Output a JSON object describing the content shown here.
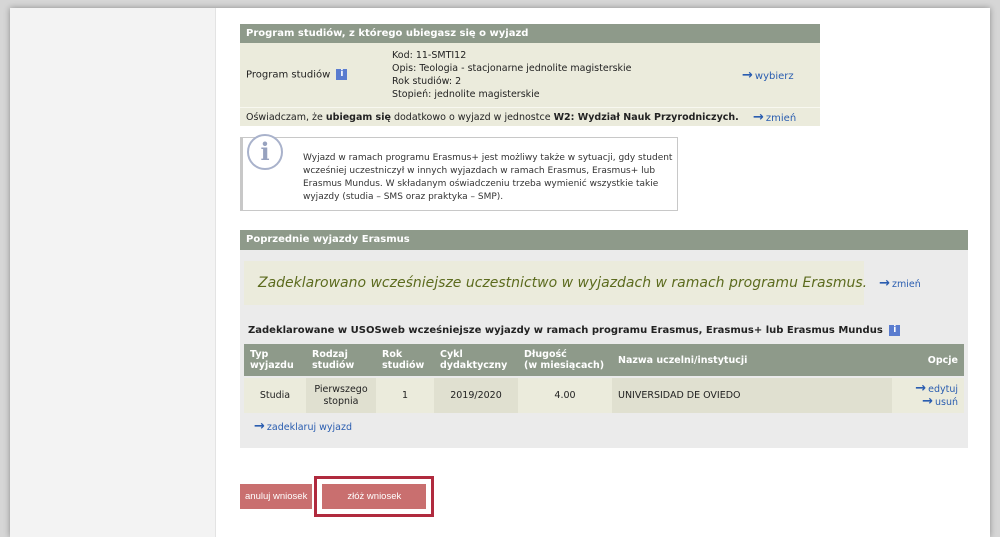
{
  "program": {
    "header": "Program studiów, z którego ubiegasz się o wyjazd",
    "label": "Program studiów",
    "details": [
      "Kod: 11-SMTI12",
      "Opis: Teologia - stacjonarne jednolite magisterskie",
      "Rok studiów: 2",
      "Stopień: jednolite magisterskie"
    ],
    "choose_link": "wybierz",
    "decl_prefix": "Oświadczam, że ",
    "decl_bold1": "ubiegam się",
    "decl_middle": " dodatkowo o wyjazd w jednostce ",
    "decl_bold2": "W2: Wydział Nauk Przyrodniczych.",
    "change_link": "zmień"
  },
  "notice": {
    "icon": "i",
    "text": "Wyjazd w ramach programu Erasmus+ jest możliwy także w sytuacji, gdy student wcześniej uczestniczył w innych wyjazdach w ramach Erasmus, Erasmus+ lub Erasmus Mundus. W składanym oświadczeniu trzeba wymienić wszystkie takie wyjazdy (studia – SMS oraz praktyka – SMP)."
  },
  "previous": {
    "header": "Poprzednie wyjazdy Erasmus",
    "declared_message": "Zadeklarowano wcześniejsze uczestnictwo w wyjazdach w ramach programu Erasmus.",
    "change_link": "zmień",
    "table_title": "Zadeklarowane w USOSweb wcześniejsze wyjazdy w ramach programu Erasmus, Erasmus+ lub Erasmus Mundus",
    "columns": {
      "c1a": "Typ",
      "c1b": "wyjazdu",
      "c2a": "Rodzaj",
      "c2b": "studiów",
      "c3a": "Rok",
      "c3b": "studiów",
      "c4a": "Cykl",
      "c4b": "dydaktyczny",
      "c5a": "Długość",
      "c5b": "(w miesiącach)",
      "c6": "Nazwa uczelni/instytucji",
      "c7": "Opcje"
    },
    "row": {
      "type": "Studia",
      "kind_a": "Pierwszego",
      "kind_b": "stopnia",
      "year": "1",
      "cycle": "2019/2020",
      "length": "4.00",
      "institution": "UNIVERSIDAD DE OVIEDO",
      "edit": "edytuj",
      "delete": "usuń"
    },
    "add_link": "zadeklaruj wyjazd"
  },
  "buttons": {
    "cancel": "anuluj wniosek",
    "submit": "złóż wniosek"
  },
  "icons": {
    "info": "info-icon",
    "arrow": "arrow-right-icon"
  },
  "colors": {
    "section_header": "#8e9a8a",
    "panel": "#ebebdc",
    "link": "#2a5db0",
    "button": "#c96f6f",
    "highlight": "#b02a3e",
    "declared_text": "#5c6b1e"
  }
}
